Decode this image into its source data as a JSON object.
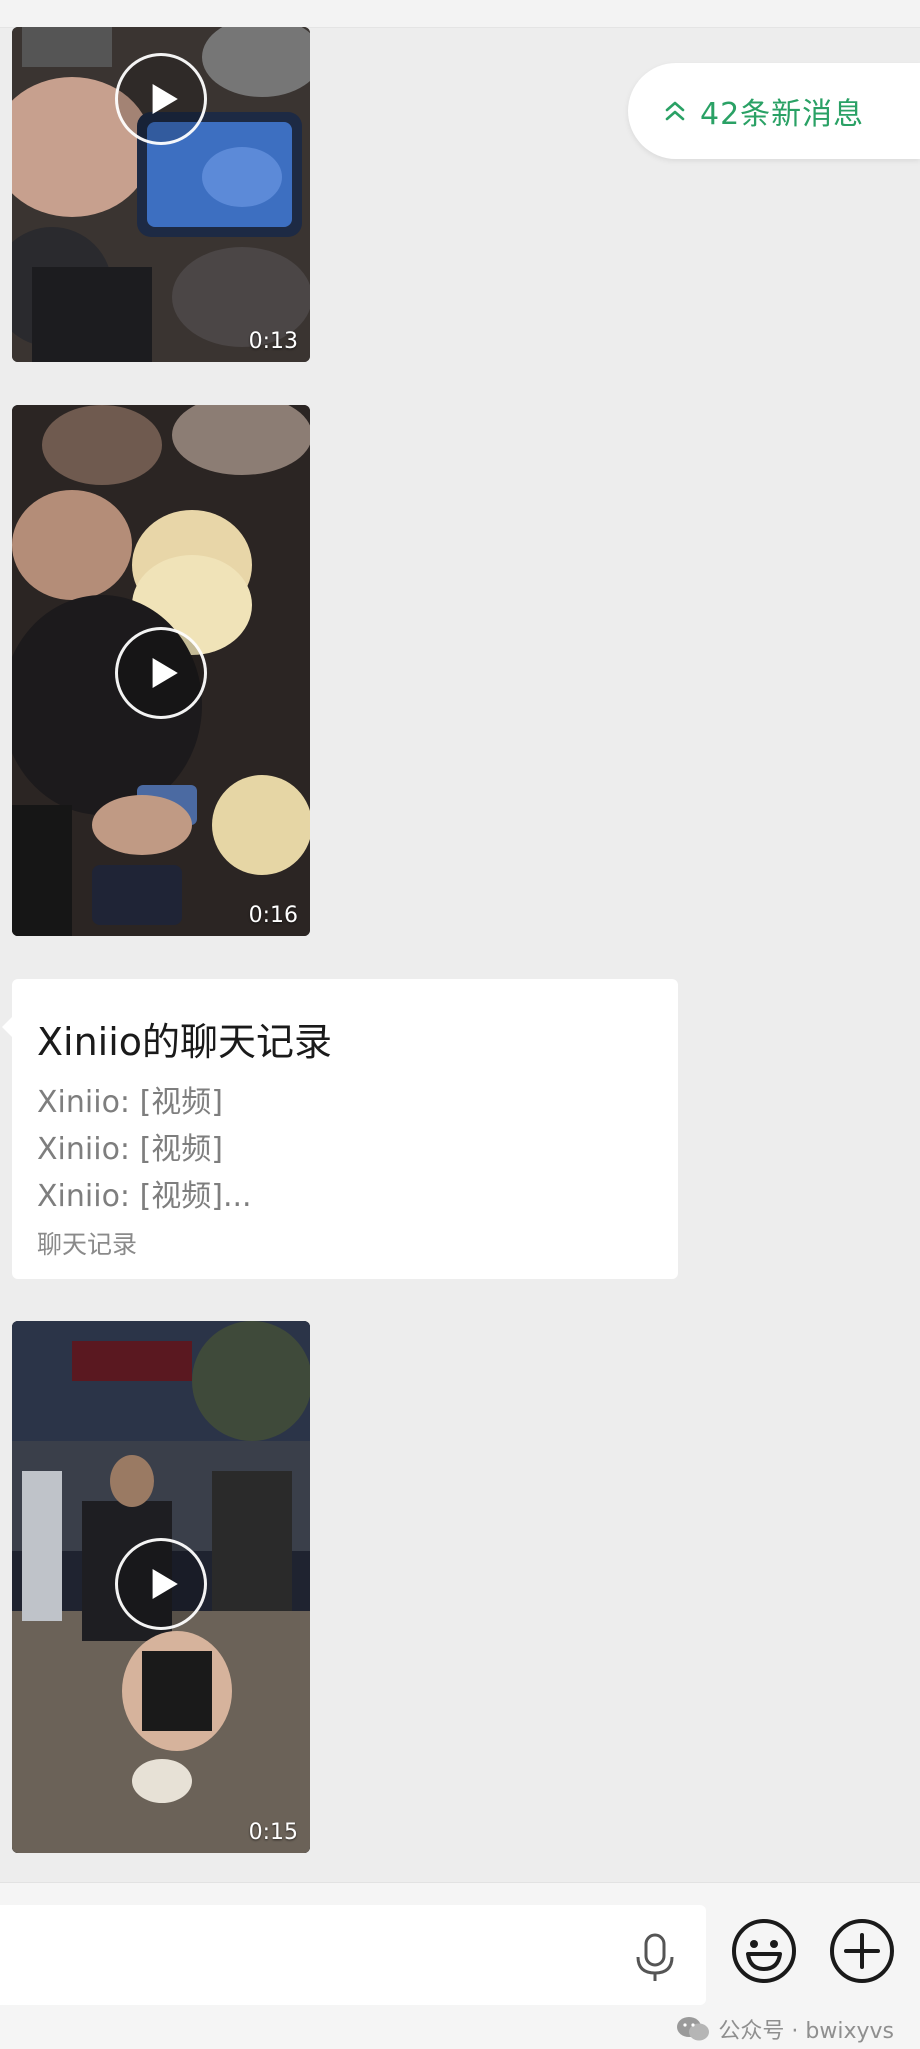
{
  "new_messages": {
    "label": "42条新消息"
  },
  "messages": [
    {
      "type": "video",
      "duration": "0:13"
    },
    {
      "type": "video",
      "duration": "0:16"
    },
    {
      "type": "chat_record",
      "title": "Xiniio的聊天记录",
      "lines": [
        "Xiniio: [视频]",
        "Xiniio: [视频]",
        "Xiniio: [视频]..."
      ],
      "footer": "聊天记录"
    },
    {
      "type": "video",
      "duration": "0:15"
    }
  ],
  "watermark": {
    "text": "公众号 · bwixyvs"
  },
  "icons": {
    "new_messages": "double-chevron-up-icon",
    "input": [
      "microphone-icon",
      "emoji-icon",
      "plus-icon"
    ],
    "video": "play-icon",
    "watermark": "wechat-icon"
  },
  "colors": {
    "accent": "#2aa165",
    "background": "#ededed",
    "bubble": "#ffffff"
  }
}
